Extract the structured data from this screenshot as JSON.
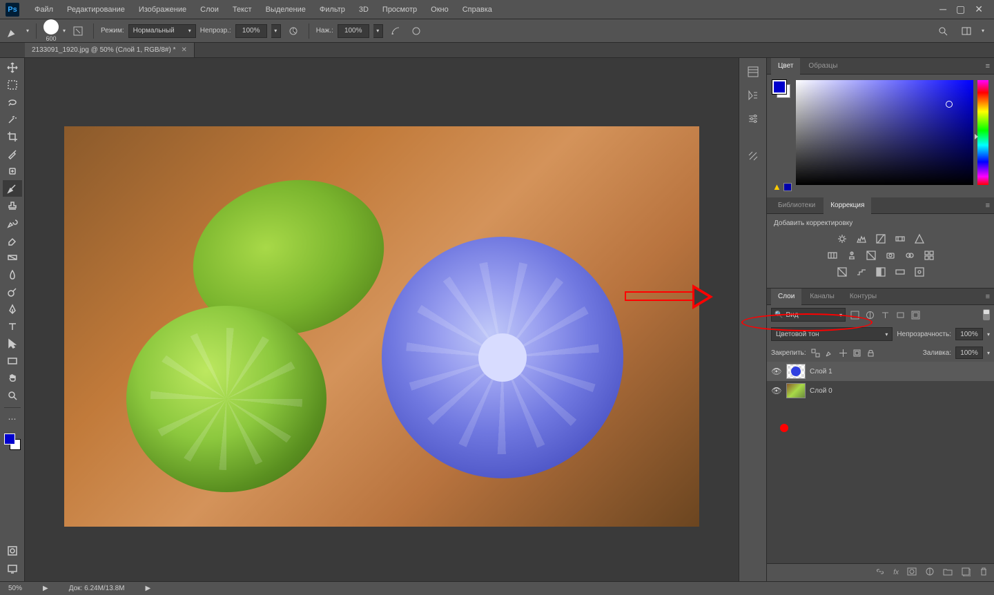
{
  "menu": {
    "items": [
      "Файл",
      "Редактирование",
      "Изображение",
      "Слои",
      "Текст",
      "Выделение",
      "Фильтр",
      "3D",
      "Просмотр",
      "Окно",
      "Справка"
    ]
  },
  "options": {
    "brush_size": "600",
    "mode_label": "Режим:",
    "mode_value": "Нормальный",
    "opacity_label": "Непрозр.:",
    "opacity_value": "100%",
    "flow_label": "Наж.:",
    "flow_value": "100%"
  },
  "document": {
    "tab_title": "2133091_1920.jpg @ 50% (Слой 1, RGB/8#) *"
  },
  "panels": {
    "color_tabs": [
      "Цвет",
      "Образцы"
    ],
    "lib_tabs": [
      "Библиотеки",
      "Коррекция"
    ],
    "adj_title": "Добавить корректировку",
    "layer_tabs": [
      "Слои",
      "Каналы",
      "Контуры"
    ],
    "filter_label": "Вид",
    "blend_mode": "Цветовой тон",
    "opacity_label": "Непрозрачность:",
    "opacity_value": "100%",
    "lock_label": "Закрепить:",
    "fill_label": "Заливка:",
    "fill_value": "100%",
    "layers": [
      {
        "name": "Слой 1"
      },
      {
        "name": "Слой 0"
      }
    ]
  },
  "status": {
    "zoom": "50%",
    "doc_label": "Док:",
    "doc_info": "6.24M/13.8M"
  }
}
